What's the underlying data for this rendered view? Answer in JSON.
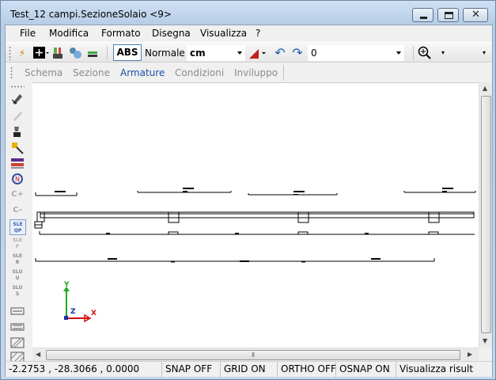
{
  "window": {
    "title": "Test_12 campi.SezioneSolaio <9>"
  },
  "menu": [
    "File",
    "Modifica",
    "Formato",
    "Disegna",
    "Visualizza",
    "?"
  ],
  "toolbar": {
    "abs_label": "ABS",
    "style_label": "Normale",
    "unit_value": "cm",
    "layer_value": "0"
  },
  "tabs": [
    {
      "label": "Schema",
      "active": false
    },
    {
      "label": "Sezione",
      "active": false
    },
    {
      "label": "Armature",
      "active": true
    },
    {
      "label": "Condizioni",
      "active": false
    },
    {
      "label": "Inviluppo",
      "active": false
    }
  ],
  "left_tools": [
    {
      "icon": "arrow-pencil-icon",
      "text": ""
    },
    {
      "icon": "eraser-icon",
      "text": ""
    },
    {
      "icon": "paint-icon",
      "text": ""
    },
    {
      "icon": "wand-icon",
      "text": ""
    },
    {
      "icon": "beam-icon",
      "text": ""
    },
    {
      "icon": "rotate-icon",
      "text": ""
    },
    {
      "icon": "c-plus-icon",
      "text": "C+"
    },
    {
      "icon": "c-minus-icon",
      "text": "C-"
    },
    {
      "icon": "sle-qp-icon",
      "text": "SLE QP"
    },
    {
      "icon": "sle-f-icon",
      "text": "SLE F"
    },
    {
      "icon": "sle-r-icon",
      "text": "SLE R"
    },
    {
      "icon": "slu-u-icon",
      "text": "SLU U"
    },
    {
      "icon": "slu-s-icon",
      "text": "SLU S"
    },
    {
      "icon": "section-1-icon",
      "text": ""
    },
    {
      "icon": "section-2-icon",
      "text": ""
    },
    {
      "icon": "hatch-1-icon",
      "text": ""
    },
    {
      "icon": "hatch-2-icon",
      "text": ""
    }
  ],
  "axes": {
    "y": "Y",
    "z": "Z",
    "x": "X"
  },
  "status": {
    "coords": "-2.2753 , -28.3066 , 0.0000",
    "snap": "SNAP OFF",
    "grid": "GRID ON",
    "ortho": "ORTHO OFF",
    "osnap": "OSNAP ON",
    "message": "Visualizza risult"
  }
}
